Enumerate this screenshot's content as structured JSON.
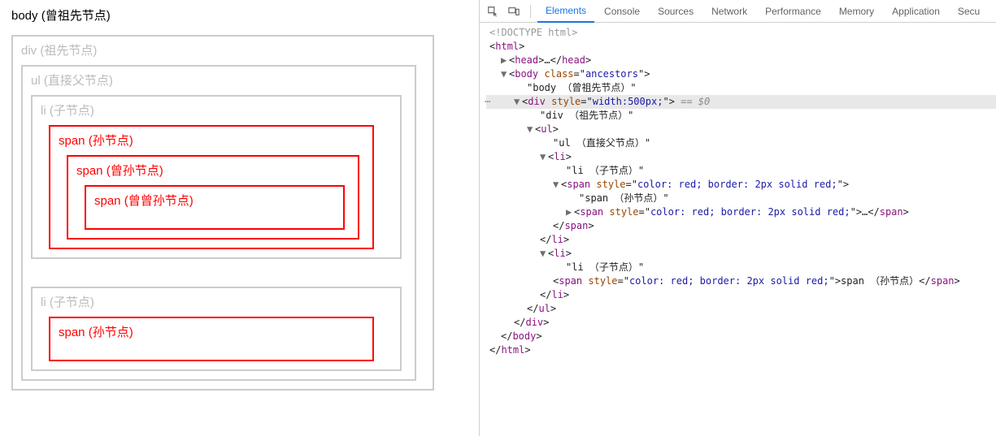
{
  "page": {
    "body_label": "body (曾祖先节点)",
    "div_label": "div (祖先节点)",
    "ul_label": "ul (直接父节点)",
    "li1_label": "li (子节点)",
    "span1_label": "span (孙节点)",
    "span2_label": "span (曾孙节点)",
    "span3_label": "span (曾曾孙节点)",
    "li2_label": "li (子节点)",
    "span1b_label": "span (孙节点)"
  },
  "devtools": {
    "tabs": {
      "elements": "Elements",
      "console": "Console",
      "sources": "Sources",
      "network": "Network",
      "performance": "Performance",
      "memory": "Memory",
      "application": "Application",
      "security": "Secu"
    },
    "tree": {
      "doctype": "<!DOCTYPE html>",
      "html_open": "html",
      "head_open": "head",
      "head_ellipsis": "…",
      "head_close": "head",
      "body_tag": "body",
      "body_attr_class": "class",
      "body_attr_class_v": "ancestors",
      "body_txt": "\"body （曾祖先节点）\"",
      "div_tag": "div",
      "div_attr_style": "style",
      "div_attr_style_v": "width:500px;",
      "eq0": " == $0",
      "div_txt": "\"div （祖先节点）\"",
      "ul_tag": "ul",
      "ul_txt": "\"ul （直接父节点）\"",
      "li_tag": "li",
      "li_txt": "\"li （子节点）\"",
      "span_tag": "span",
      "span_attr_style": "style",
      "span_style_v": "color: red; border: 2px solid red;",
      "span_txt1": "\"span （孙节点）\"",
      "span_inline_txt": "span （孙节点）",
      "span_ellipsis": "…",
      "close_span": "span",
      "close_li": "li",
      "close_ul": "ul",
      "close_div": "div",
      "close_body": "body",
      "close_html": "html"
    }
  }
}
